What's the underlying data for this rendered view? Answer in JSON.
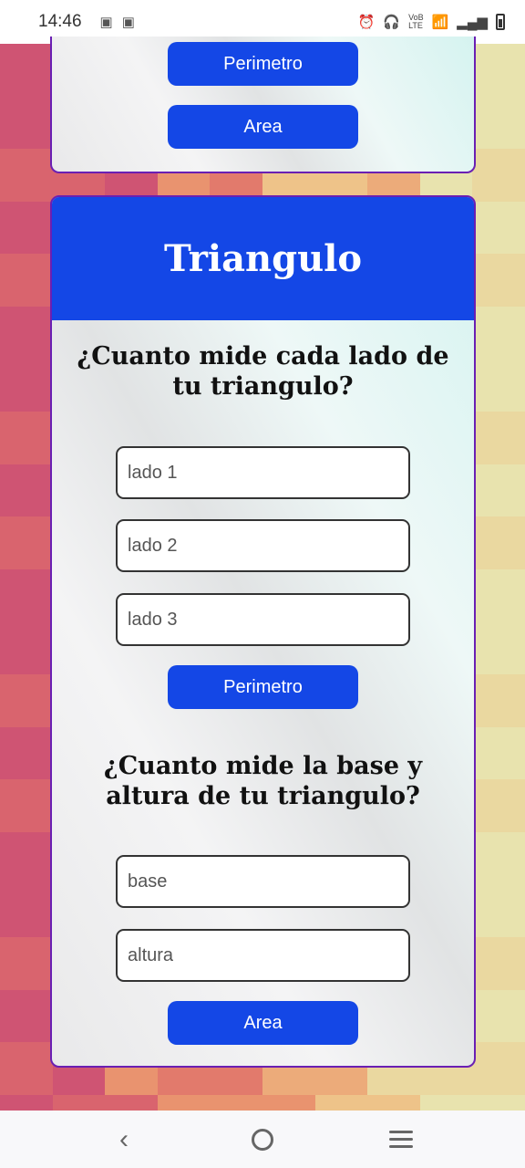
{
  "status_bar": {
    "time": "14:46",
    "notifications": [
      "📷",
      "📷"
    ],
    "right_icons": [
      "alarm-icon",
      "headphones-icon",
      "volte-icon",
      "wifi-icon",
      "signal-icon",
      "battery-icon"
    ],
    "volte_label": "VoB LTE"
  },
  "top_card": {
    "perimeter_button": "Perimetro",
    "area_button": "Area"
  },
  "triangle_card": {
    "title": "Triangulo",
    "sides_question": "¿Cuanto mide cada lado de tu triangulo?",
    "side1_placeholder": "lado 1",
    "side2_placeholder": "lado 2",
    "side3_placeholder": "lado 3",
    "perimeter_button": "Perimetro",
    "base_question": "¿Cuanto mide la base y altura de tu triangulo?",
    "base_placeholder": "base",
    "height_placeholder": "altura",
    "area_button": "Area"
  },
  "colors": {
    "accent": "#1447e6",
    "card_border": "#6a1fb3"
  }
}
